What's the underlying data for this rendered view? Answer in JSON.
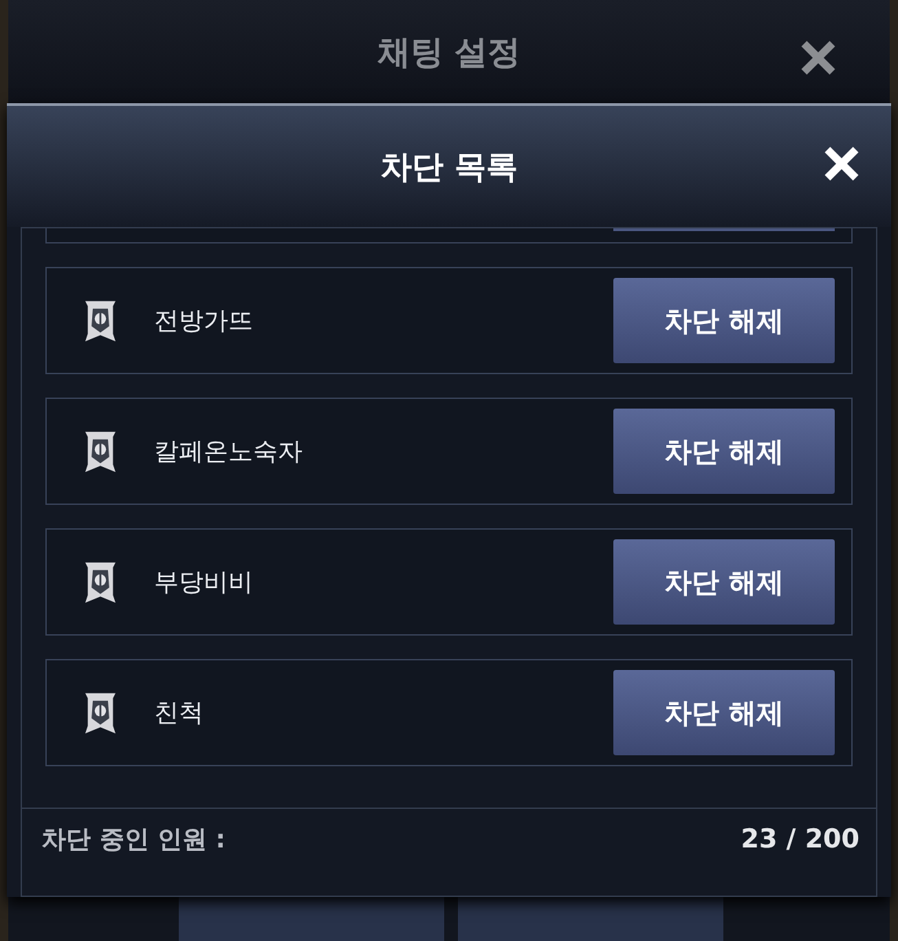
{
  "background_dialog": {
    "title": "채팅 설정"
  },
  "dialog": {
    "title": "차단 목록",
    "blocked_users": [
      {
        "name": "전방가뜨",
        "button": "차단 해제"
      },
      {
        "name": "칼페온노숙자",
        "button": "차단 해제"
      },
      {
        "name": "부당비비",
        "button": "차단 해제"
      },
      {
        "name": "친척",
        "button": "차단 해제"
      }
    ],
    "footer": {
      "label": "차단 중인 인원 :",
      "count": "23 / 200"
    }
  }
}
